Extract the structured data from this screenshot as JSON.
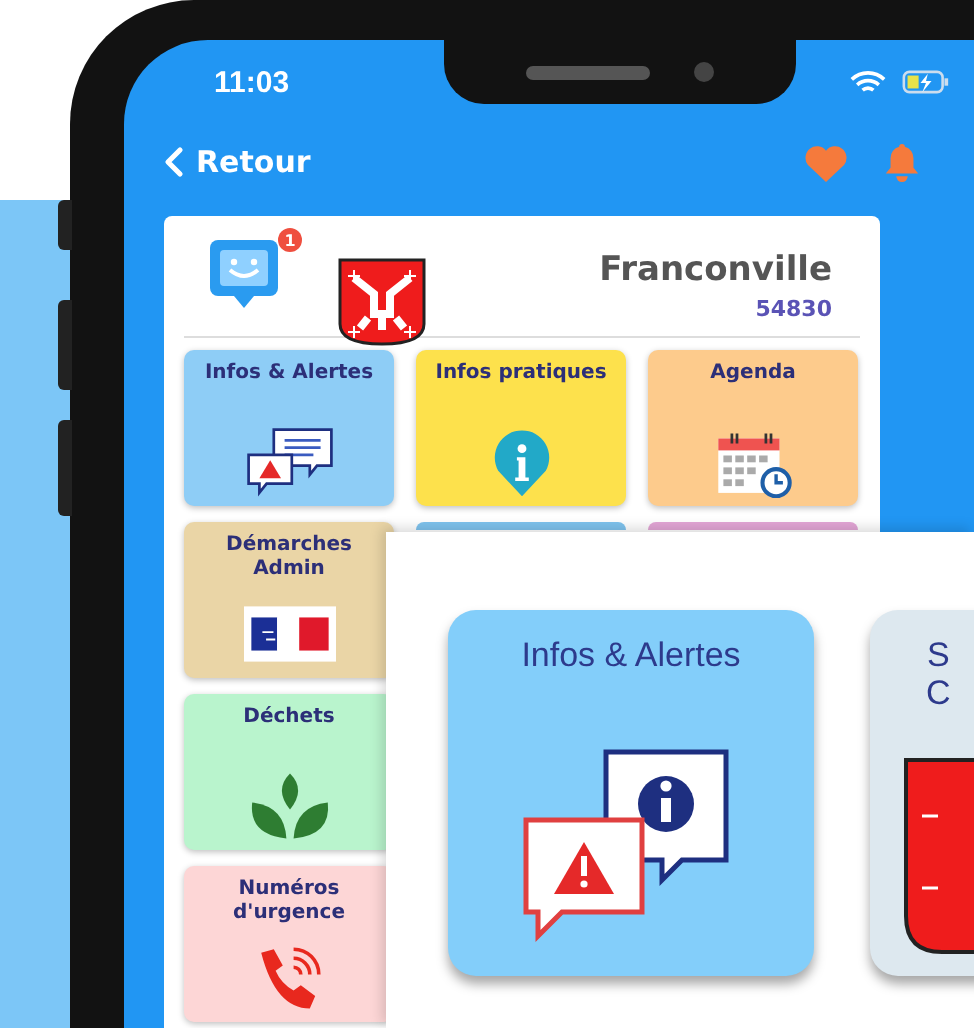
{
  "status_bar": {
    "time": "11:03"
  },
  "nav": {
    "back_label": "Retour"
  },
  "header": {
    "notification_badge": "1",
    "city": "Franconville",
    "postal_code": "54830"
  },
  "tiles": [
    {
      "title": "Infos & Alertes",
      "kind": "alerts",
      "color": "#8ecdf6"
    },
    {
      "title": "Infos pratiques",
      "kind": "info",
      "color": "#fde14c"
    },
    {
      "title": "Agenda",
      "kind": "calendar",
      "color": "#fdcb8c"
    },
    {
      "title": "Démarches Admin",
      "kind": "admin",
      "color": "#ead5a6"
    },
    {
      "kind": "blank",
      "color": "#7fc3ee"
    },
    {
      "kind": "blank",
      "color": "#e3a6d6"
    },
    {
      "title": "Déchets",
      "kind": "waste",
      "color": "#b9f4cd"
    },
    {
      "title": "Numéros d'urgence",
      "kind": "phone",
      "color": "#fdd6d6"
    }
  ],
  "zoom_panel": {
    "cards": [
      {
        "title_lines": [
          "Infos & Alertes"
        ],
        "kind": "alerts",
        "color": "#83cefa"
      },
      {
        "title_lines": [
          "S",
          "C"
        ],
        "kind": "crest",
        "color": "#dde8ef"
      }
    ]
  }
}
